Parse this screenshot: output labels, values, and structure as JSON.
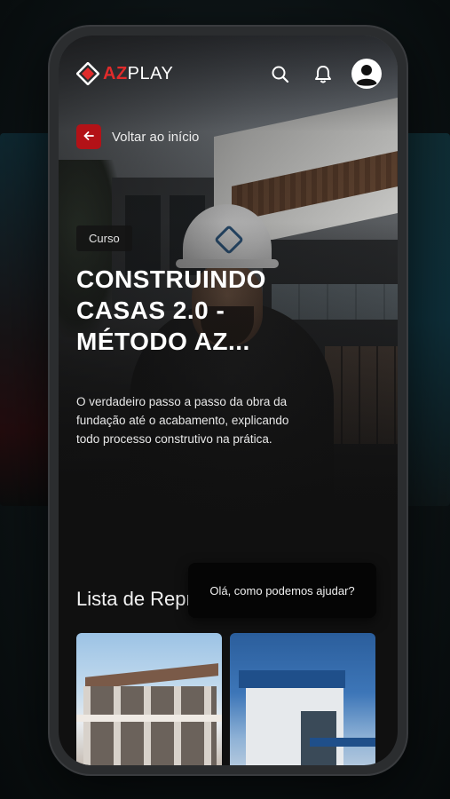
{
  "app": {
    "brand_az": "AZ",
    "brand_play": "PLAY",
    "brand_color": "#e02b2b"
  },
  "header": {
    "icons": [
      "search-icon",
      "bell-icon",
      "user-avatar-icon"
    ]
  },
  "back": {
    "label": "Voltar ao início",
    "icon": "arrow-left-icon",
    "color": "#b31217"
  },
  "course": {
    "badge": "Curso",
    "title": "CONSTRUINDO CASAS 2.0 - MÉTODO AZ...",
    "description": "O verdadeiro passo a passo da obra da fundação até o acabamento, explicando todo processo construtivo na prática."
  },
  "list": {
    "title": "Lista de Reprodução",
    "items": [
      {
        "thumbnail": "construction-frame-image"
      },
      {
        "thumbnail": "modern-house-image"
      }
    ]
  },
  "chat": {
    "message": "Olá, como podemos ajudar?"
  }
}
